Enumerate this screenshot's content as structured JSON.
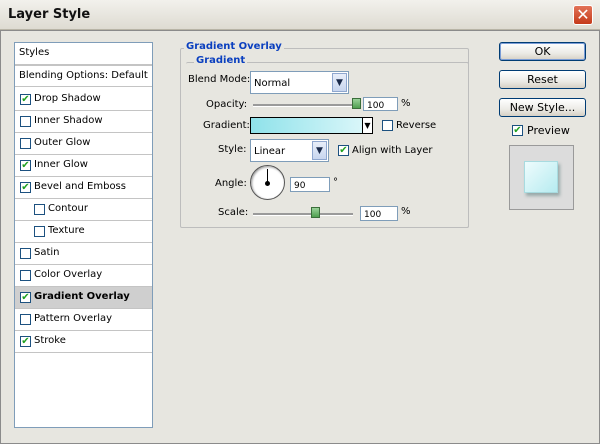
{
  "window": {
    "title": "Layer Style",
    "close_glyph": "✕"
  },
  "styles_list": {
    "header": "Styles",
    "blending": "Blending Options: Default",
    "items": [
      {
        "label": "Drop Shadow",
        "checked": true
      },
      {
        "label": "Inner Shadow",
        "checked": false
      },
      {
        "label": "Outer Glow",
        "checked": false
      },
      {
        "label": "Inner Glow",
        "checked": true
      },
      {
        "label": "Bevel and Emboss",
        "checked": true
      },
      {
        "label": "Contour",
        "checked": false
      },
      {
        "label": "Texture",
        "checked": false
      },
      {
        "label": "Satin",
        "checked": false
      },
      {
        "label": "Color Overlay",
        "checked": false
      },
      {
        "label": "Gradient Overlay",
        "checked": true
      },
      {
        "label": "Pattern Overlay",
        "checked": false
      },
      {
        "label": "Stroke",
        "checked": true
      }
    ],
    "selected": "Gradient Overlay"
  },
  "panel": {
    "title": "Gradient Overlay",
    "subtitle": "Gradient",
    "blend_mode_label": "Blend Mode:",
    "blend_mode_value": "Normal",
    "opacity_label": "Opacity:",
    "opacity_value": "100",
    "opacity_unit": "%",
    "gradient_label": "Gradient:",
    "gradient_colors": [
      "#8fe2ea",
      "#d9f6f9"
    ],
    "reverse_label": "Reverse",
    "reverse_checked": false,
    "style_label": "Style:",
    "style_value": "Linear",
    "align_label": "Align with Layer",
    "align_checked": true,
    "angle_label": "Angle:",
    "angle_value": "90",
    "angle_unit": "°",
    "scale_label": "Scale:",
    "scale_value": "100",
    "scale_unit": "%"
  },
  "buttons": {
    "ok": "OK",
    "reset": "Reset",
    "new_style": "New Style...",
    "preview_label": "Preview",
    "preview_checked": true
  },
  "colors": {
    "accent": "#0a3fbf",
    "check": "#21a121",
    "preview_fill": "#b6ebf0"
  }
}
